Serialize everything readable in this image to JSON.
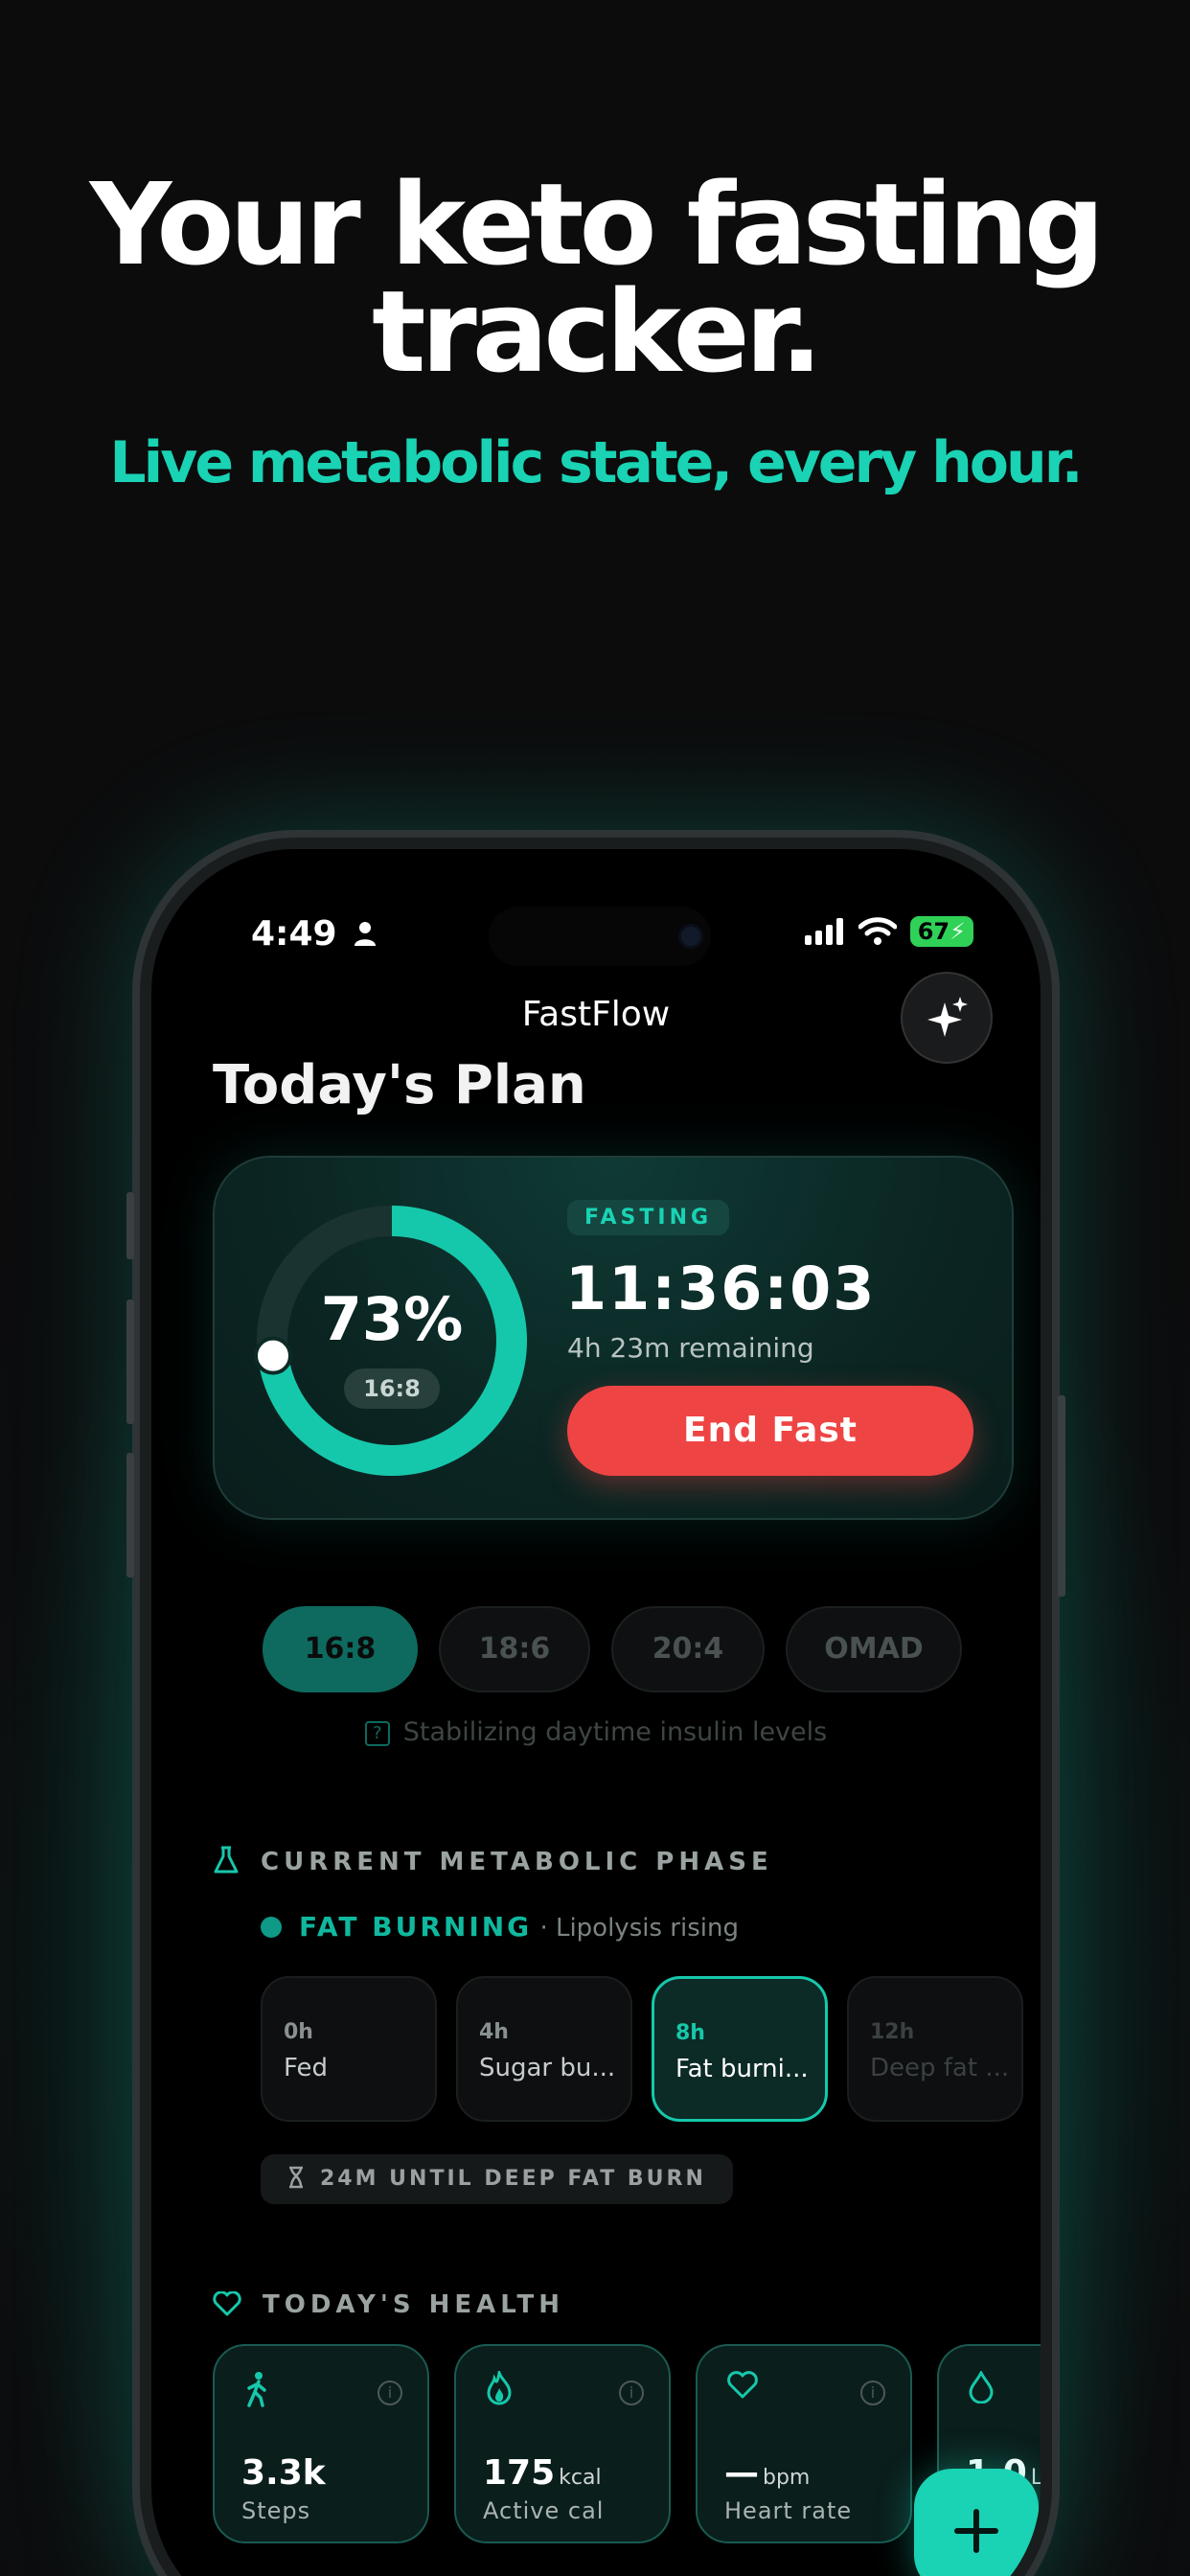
{
  "headline": {
    "line1": "Your keto fasting",
    "line2": "tracker.",
    "subline": "Live metabolic state, every hour."
  },
  "status_bar": {
    "time": "4:49",
    "battery": "67"
  },
  "app": {
    "title": "FastFlow",
    "page_title": "Today's Plan"
  },
  "timer_card": {
    "progress_percent_label": "73%",
    "progress": 0.73,
    "plan_tag": "16:8",
    "state_badge": "FASTING",
    "elapsed": "11:36:03",
    "remaining": "4h 23m remaining",
    "end_button": "End Fast"
  },
  "plans": {
    "options": [
      "16:8",
      "18:6",
      "20:4",
      "OMAD"
    ],
    "selected": "16:8",
    "note": "Stabilizing daytime insulin levels"
  },
  "metabolic": {
    "section_title": "CURRENT METABOLIC PHASE",
    "current_phase": "FAT BURNING",
    "current_sub": "· Lipolysis rising",
    "phases": [
      {
        "hour": "0h",
        "name": "Fed"
      },
      {
        "hour": "4h",
        "name": "Sugar bu..."
      },
      {
        "hour": "8h",
        "name": "Fat burni..."
      },
      {
        "hour": "12h",
        "name": "Deep fat ..."
      }
    ],
    "countdown": "24M UNTIL DEEP FAT BURN"
  },
  "health": {
    "section_title": "TODAY'S HEALTH",
    "cards": [
      {
        "icon": "walking-icon",
        "value": "3.3k",
        "unit": "",
        "label": "Steps"
      },
      {
        "icon": "flame-icon",
        "value": "175",
        "unit": "kcal",
        "label": "Active cal"
      },
      {
        "icon": "heart-icon",
        "value": "—",
        "unit": "bpm",
        "label": "Heart rate"
      },
      {
        "icon": "water-drop-icon",
        "value": "1.0",
        "unit": "L",
        "label": ""
      }
    ]
  },
  "colors": {
    "accent": "#19d3b4",
    "danger": "#ef4444",
    "background": "#0c0c0d"
  }
}
